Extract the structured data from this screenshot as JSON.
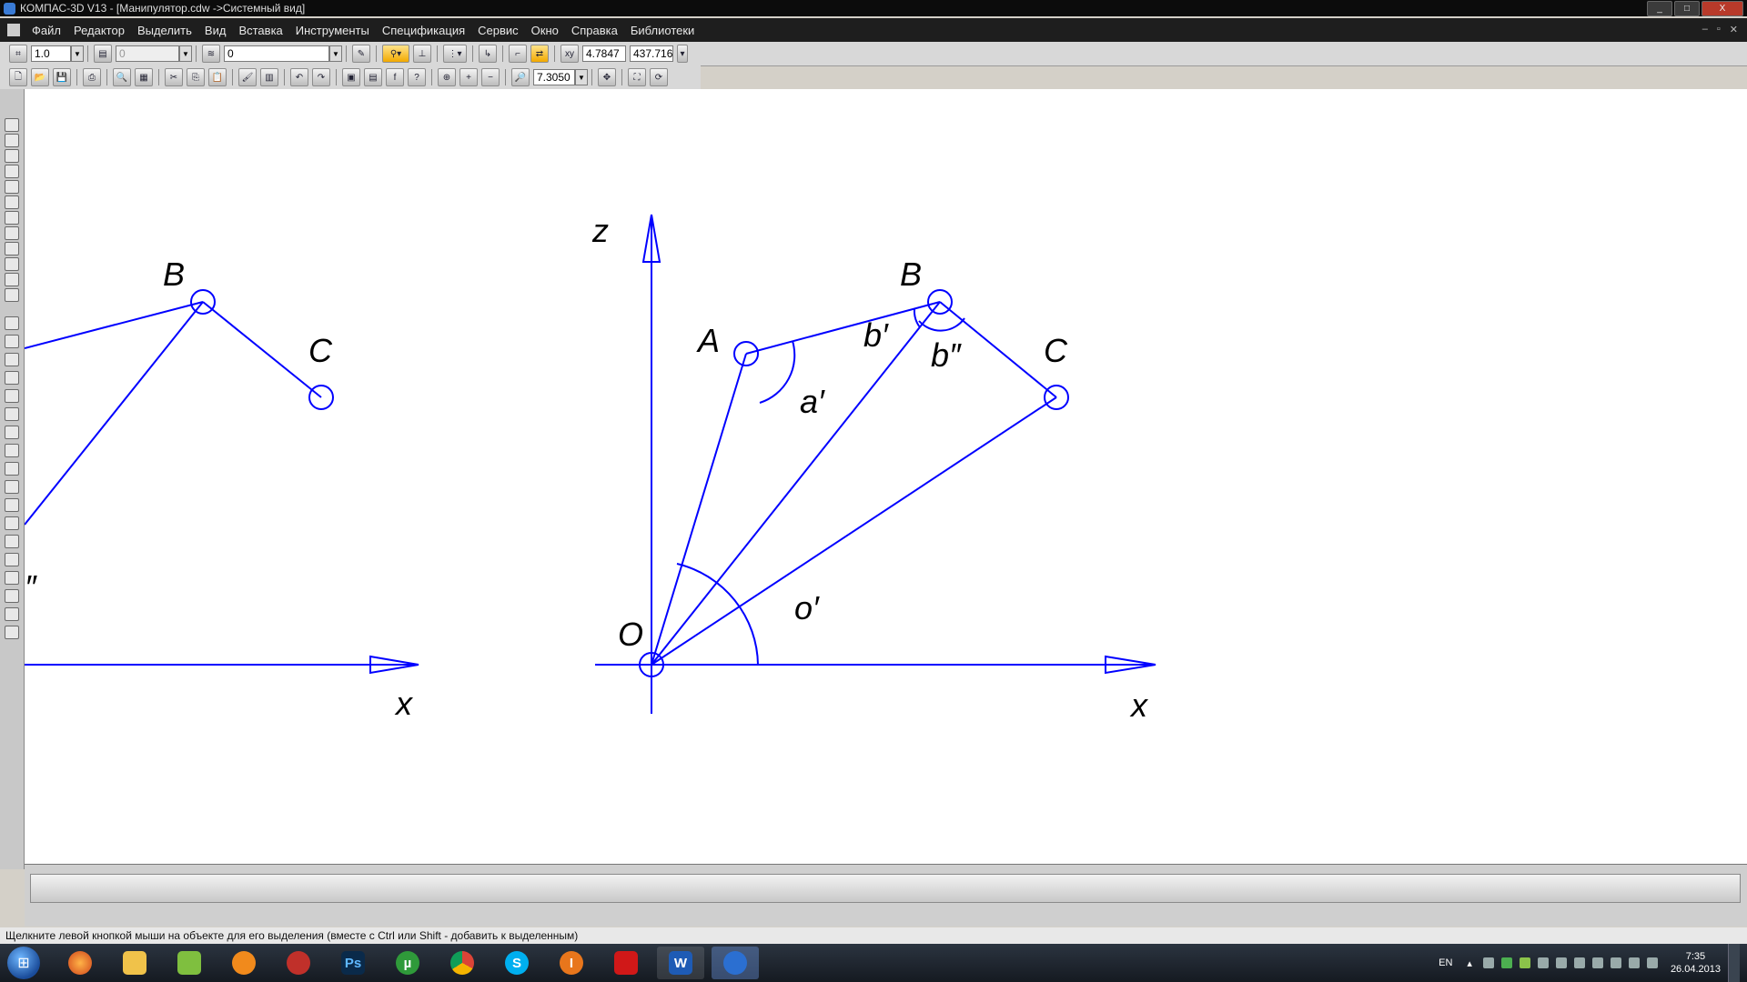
{
  "window": {
    "title": "КОМПАС-3D V13 - [Манипулятор.cdw ->Системный вид]",
    "buttons": [
      "_",
      "□",
      "X"
    ]
  },
  "menu": {
    "items": [
      "Файл",
      "Редактор",
      "Выделить",
      "Вид",
      "Вставка",
      "Инструменты",
      "Спецификация",
      "Сервис",
      "Окно",
      "Справка",
      "Библиотеки"
    ]
  },
  "toolbar1": {
    "step_value": "1.0",
    "layer_value": "0",
    "view_value": "0",
    "coord_x": "4.7847",
    "coord_y": "437.716"
  },
  "toolbar2": {
    "zoom_value": "7.3050"
  },
  "drawing": {
    "left_fragment": {
      "label_b": "B",
      "label_c": "C",
      "label_x": "x",
      "label_partial": "″"
    },
    "main": {
      "label_z": "z",
      "label_x": "x",
      "label_o": "O",
      "label_a": "A",
      "label_b": "B",
      "label_c": "C",
      "angle_a": "a′",
      "angle_b1": "b′",
      "angle_b2": "b″",
      "angle_o": "o′"
    },
    "line_color": "#0000ff"
  },
  "status": {
    "hint": "Щелкните левой кнопкой мыши на объекте для его выделения (вместе с Ctrl или Shift - добавить к выделенным)"
  },
  "taskbar": {
    "apps": [
      "firefox",
      "explorer",
      "recycle",
      "flash",
      "pin",
      "photoshop",
      "utorrent",
      "chrome",
      "skype",
      "app-i",
      "paint",
      "word",
      "kompas"
    ],
    "ps_label": "Ps",
    "ut_label": "µ",
    "skype_label": "S",
    "i_label": "I",
    "word_label": "W",
    "lang": "EN",
    "time": "7:35",
    "date": "26.04.2013"
  }
}
